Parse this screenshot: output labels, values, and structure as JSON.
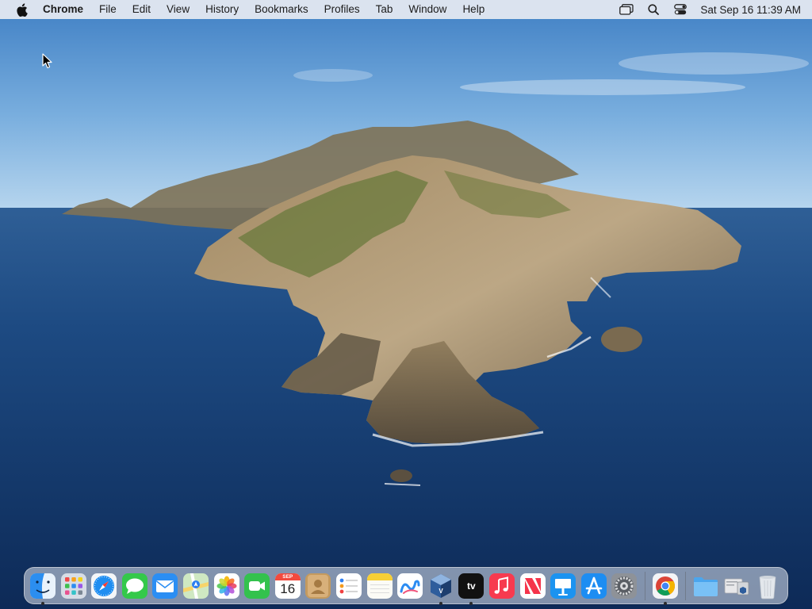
{
  "menubar": {
    "apple_icon": "apple-logo-icon",
    "app_name": "Chrome",
    "menus": [
      "File",
      "Edit",
      "View",
      "History",
      "Bookmarks",
      "Profiles",
      "Tab",
      "Window",
      "Help"
    ],
    "status_icons": [
      "screen-mirroring-icon",
      "spotlight-search-icon",
      "control-center-icon"
    ],
    "clock": "Sat Sep 16  11:39 AM"
  },
  "desktop": {
    "wallpaper": "macOS Catalina island wallpaper"
  },
  "dock": {
    "apps": [
      {
        "name": "Finder",
        "icon": "finder-icon",
        "running": true
      },
      {
        "name": "Launchpad",
        "icon": "launchpad-icon",
        "running": false
      },
      {
        "name": "Safari",
        "icon": "safari-icon",
        "running": false
      },
      {
        "name": "Messages",
        "icon": "messages-icon",
        "running": false
      },
      {
        "name": "Mail",
        "icon": "mail-icon",
        "running": false
      },
      {
        "name": "Maps",
        "icon": "maps-icon",
        "running": false
      },
      {
        "name": "Photos",
        "icon": "photos-icon",
        "running": false
      },
      {
        "name": "FaceTime",
        "icon": "facetime-icon",
        "running": false
      },
      {
        "name": "Calendar",
        "icon": "calendar-icon",
        "running": false,
        "month": "SEP",
        "day": "16"
      },
      {
        "name": "Contacts",
        "icon": "contacts-icon",
        "running": false
      },
      {
        "name": "Reminders",
        "icon": "reminders-icon",
        "running": false
      },
      {
        "name": "Notes",
        "icon": "notes-icon",
        "running": false
      },
      {
        "name": "Freeform",
        "icon": "freeform-icon",
        "running": false
      },
      {
        "name": "VirtualBox",
        "icon": "virtualbox-icon",
        "running": true
      },
      {
        "name": "TV",
        "icon": "apple-tv-icon",
        "running": true,
        "label": "tv"
      },
      {
        "name": "Music",
        "icon": "music-icon",
        "running": false
      },
      {
        "name": "News",
        "icon": "news-icon",
        "running": false
      },
      {
        "name": "Keynote",
        "icon": "keynote-icon",
        "running": false
      },
      {
        "name": "App Store",
        "icon": "app-store-icon",
        "running": false
      },
      {
        "name": "System Settings",
        "icon": "system-settings-icon",
        "running": false
      },
      {
        "name": "Google Chrome",
        "icon": "chrome-icon",
        "running": true
      },
      {
        "name": "Downloads",
        "icon": "folder-icon",
        "running": false
      },
      {
        "name": "Document Stack",
        "icon": "document-stack-icon",
        "running": false
      },
      {
        "name": "Trash",
        "icon": "trash-icon",
        "running": false
      }
    ]
  }
}
